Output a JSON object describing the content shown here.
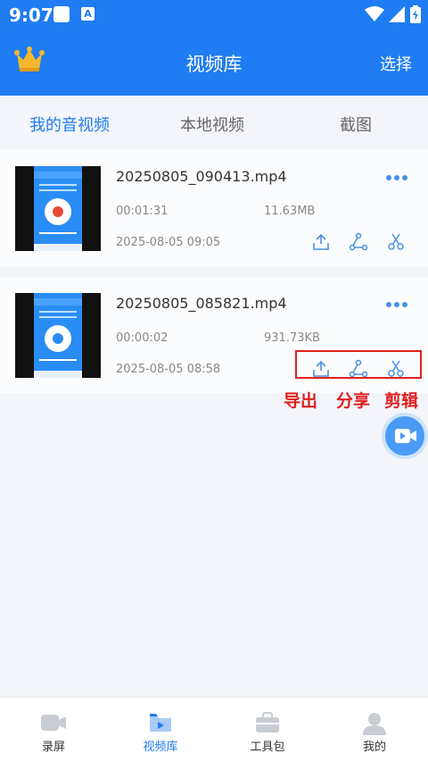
{
  "status_bar": {
    "time": "9:07",
    "a_badge": "A"
  },
  "app_bar": {
    "title": "视频库",
    "select": "选择",
    "crown_icon": "crown-icon",
    "brand_color": "#1f7cf2"
  },
  "tabs": [
    {
      "label": "我的音视频",
      "active": true
    },
    {
      "label": "本地视频",
      "active": false
    },
    {
      "label": "截图",
      "active": false
    }
  ],
  "videos": [
    {
      "name": "20250805_090413.mp4",
      "duration": "00:01:31",
      "size": "11.63MB",
      "date": "2025-08-05 09:05"
    },
    {
      "name": "20250805_085821.mp4",
      "duration": "00:00:02",
      "size": "931.73KB",
      "date": "2025-08-05 08:58"
    }
  ],
  "annotations": {
    "export": "导出",
    "share": "分享",
    "edit": "剪辑",
    "color": "#e02020"
  },
  "bottom_nav": [
    {
      "label": "录屏",
      "icon": "camera-icon",
      "active": false
    },
    {
      "label": "视频库",
      "icon": "folder-video-icon",
      "active": true
    },
    {
      "label": "工具包",
      "icon": "toolbox-icon",
      "active": false
    },
    {
      "label": "我的",
      "icon": "person-icon",
      "active": false
    }
  ]
}
